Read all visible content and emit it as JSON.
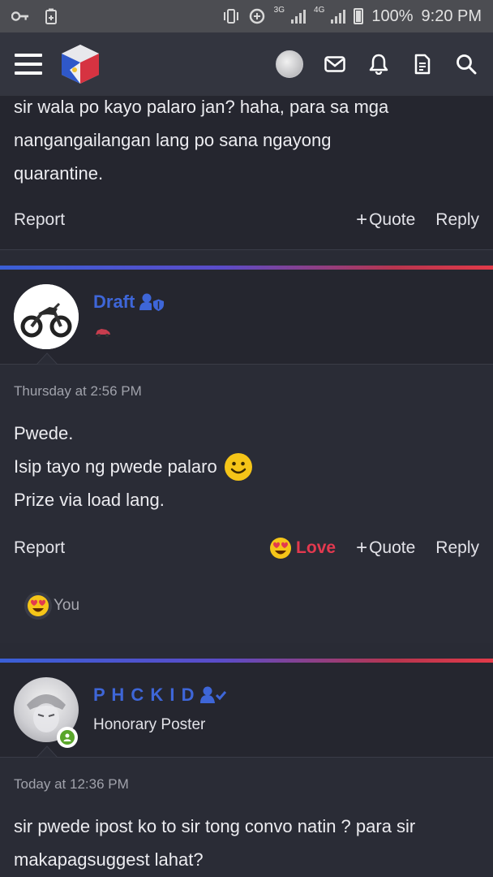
{
  "status_bar": {
    "network_1": "3G",
    "network_2": "4G",
    "battery": "100%",
    "time": "9:20 PM",
    "icons": [
      "key-icon",
      "battery-saver-icon",
      "vibrate-icon",
      "data-saver-icon",
      "signal-icon",
      "battery-icon"
    ]
  },
  "header": {
    "icons": [
      "menu-icon",
      "site-logo",
      "user-avatar",
      "envelope-icon",
      "bell-icon",
      "document-icon",
      "search-icon"
    ]
  },
  "posts": [
    {
      "text_lines": [
        "sir wala po kayo palaro jan? haha, para sa mga",
        "nangangailangan lang po sana ngayong",
        "quarantine."
      ],
      "actions": {
        "report": "Report",
        "quote": "Quote",
        "reply": "Reply"
      }
    },
    {
      "username": "Draft",
      "timestamp": "Thursday at 2:56 PM",
      "text_lines": [
        "Pwede.",
        "Isip tayo ng pwede palaro",
        "Prize via load lang."
      ],
      "actions": {
        "report": "Report",
        "love": "Love",
        "quote": "Quote",
        "reply": "Reply"
      },
      "reactions": {
        "by": "You"
      }
    },
    {
      "username": "P H C K I D",
      "user_title": "Honorary Poster",
      "timestamp": "Today at 12:36 PM",
      "text_lines": [
        "sir pwede ipost ko to sir tong convo natin ? para sir",
        "makapagsuggest lahat?"
      ]
    }
  ],
  "colors": {
    "accent_blue": "#3e66d8",
    "love_red": "#e3394f",
    "background": "#292b35",
    "header": "#33353f"
  }
}
